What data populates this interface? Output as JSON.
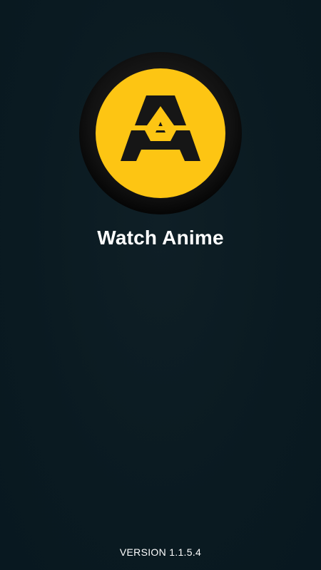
{
  "app": {
    "title": "Watch Anime",
    "version": "VERSION 1.1.5.4"
  },
  "logo": {
    "icon": "letter-a-logo-icon",
    "ring_color": "#000000",
    "fill_color": "#fdc513",
    "glyph_color": "#161616"
  },
  "theme": {
    "background": "#0b1b22",
    "text": "#ffffff"
  }
}
